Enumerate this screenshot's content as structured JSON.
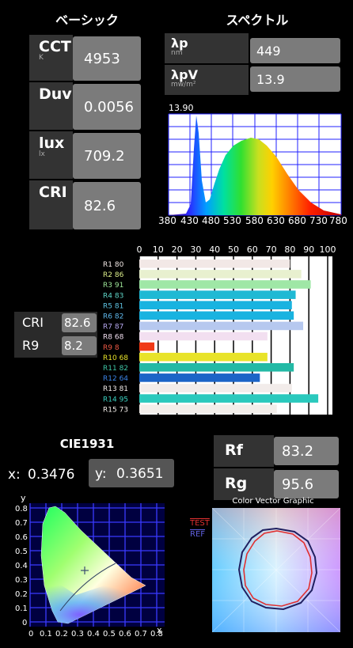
{
  "basic": {
    "title": "ベーシック",
    "rows": [
      {
        "label": "CCT",
        "unit": "K",
        "value": "4953"
      },
      {
        "label": "Duv",
        "unit": "",
        "value": "0.0056"
      },
      {
        "label": "lux",
        "unit": "lx",
        "value": "709.2"
      },
      {
        "label": "CRI",
        "unit": "",
        "value": "82.6"
      }
    ]
  },
  "spectrum": {
    "title": "スペクトル",
    "lp_label": "λp",
    "lp_unit": "nm",
    "lp_value": "449",
    "lpv_label": "λpV",
    "lpv_unit": "mw/m²",
    "lpv_value": "13.9",
    "chart_label": "13.90",
    "x_ticks": [
      "380",
      "430",
      "480",
      "530",
      "580",
      "630",
      "680",
      "730",
      "780"
    ]
  },
  "cri": {
    "cri_label": "CRI",
    "cri_value": "82.6",
    "r9_label": "R9",
    "r9_value": "8.2"
  },
  "cri_chart": {
    "x_ticks": [
      "0",
      "10",
      "20",
      "30",
      "40",
      "50",
      "60",
      "70",
      "80",
      "90",
      "100"
    ],
    "rows": [
      {
        "label": "R1",
        "value": 80,
        "color": "#f2e8e6"
      },
      {
        "label": "R2",
        "value": 86,
        "color": "#e8f0cf"
      },
      {
        "label": "R3",
        "value": 91,
        "color": "#9fe7a6"
      },
      {
        "label": "R4",
        "value": 83,
        "color": "#1fb9d4"
      },
      {
        "label": "R5",
        "value": 81,
        "color": "#19b3e0"
      },
      {
        "label": "R6",
        "value": 82,
        "color": "#19b3e0"
      },
      {
        "label": "R7",
        "value": 87,
        "color": "#b6c8ef"
      },
      {
        "label": "R8",
        "value": 68,
        "color": "#f2dff0"
      },
      {
        "label": "R9",
        "value": 8,
        "color": "#f03a16"
      },
      {
        "label": "R10",
        "value": 68,
        "color": "#e8e329"
      },
      {
        "label": "R11",
        "value": 82,
        "color": "#23b9a5"
      },
      {
        "label": "R12",
        "value": 64,
        "color": "#1b64c7"
      },
      {
        "label": "R13",
        "value": 81,
        "color": "#f2ecea"
      },
      {
        "label": "R14",
        "value": 95,
        "color": "#2ac9bd"
      },
      {
        "label": "R15",
        "value": 73,
        "color": "#f3eeea"
      }
    ],
    "label_colors": [
      "#f2e8e6",
      "#dcee8a",
      "#9fe79a",
      "#5fd6c8",
      "#5fc4e4",
      "#5fb8ec",
      "#b6a8ef",
      "#f2dff0",
      "#f05a46",
      "#e8e329",
      "#3fc6a5",
      "#3b84e7",
      "#f2ecea",
      "#3ad0c0",
      "#f3eeea"
    ],
    "row_labels": [
      "R1  80",
      "R2  86",
      "R3  91",
      "R4  83",
      "R5  81",
      "R6  82",
      "R7  87",
      "R8  68",
      "R9   8",
      "R10 68",
      "R11 82",
      "R12 64",
      "R13 81",
      "R14 95",
      "R15 73"
    ]
  },
  "cie": {
    "title": "CIE1931",
    "x_label": "x:",
    "x_value": "0.3476",
    "y_label": "y:",
    "y_value": "0.3651",
    "axis_y": "y",
    "axis_x": "x",
    "y_ticks": [
      "0.8",
      "0.7",
      "0.6",
      "0.5",
      "0.4",
      "0.3",
      "0.2",
      "0.1",
      "0"
    ],
    "x_ticks": [
      "0",
      "0.1",
      "0.2",
      "0.3",
      "0.4",
      "0.5",
      "0.6",
      "0.7",
      "0.8"
    ]
  },
  "tm30": {
    "rf_label": "Rf",
    "rf_value": "83.2",
    "rg_label": "Rg",
    "rg_value": "95.6",
    "chart_title": "Color Vector Graphic",
    "legend_test": "TEST",
    "legend_ref": "REF"
  },
  "colors": {
    "label_bg": "#333333",
    "value_bg": "#7b7b7b",
    "test_line": "#e03030",
    "ref_line": "#2020a0"
  }
}
